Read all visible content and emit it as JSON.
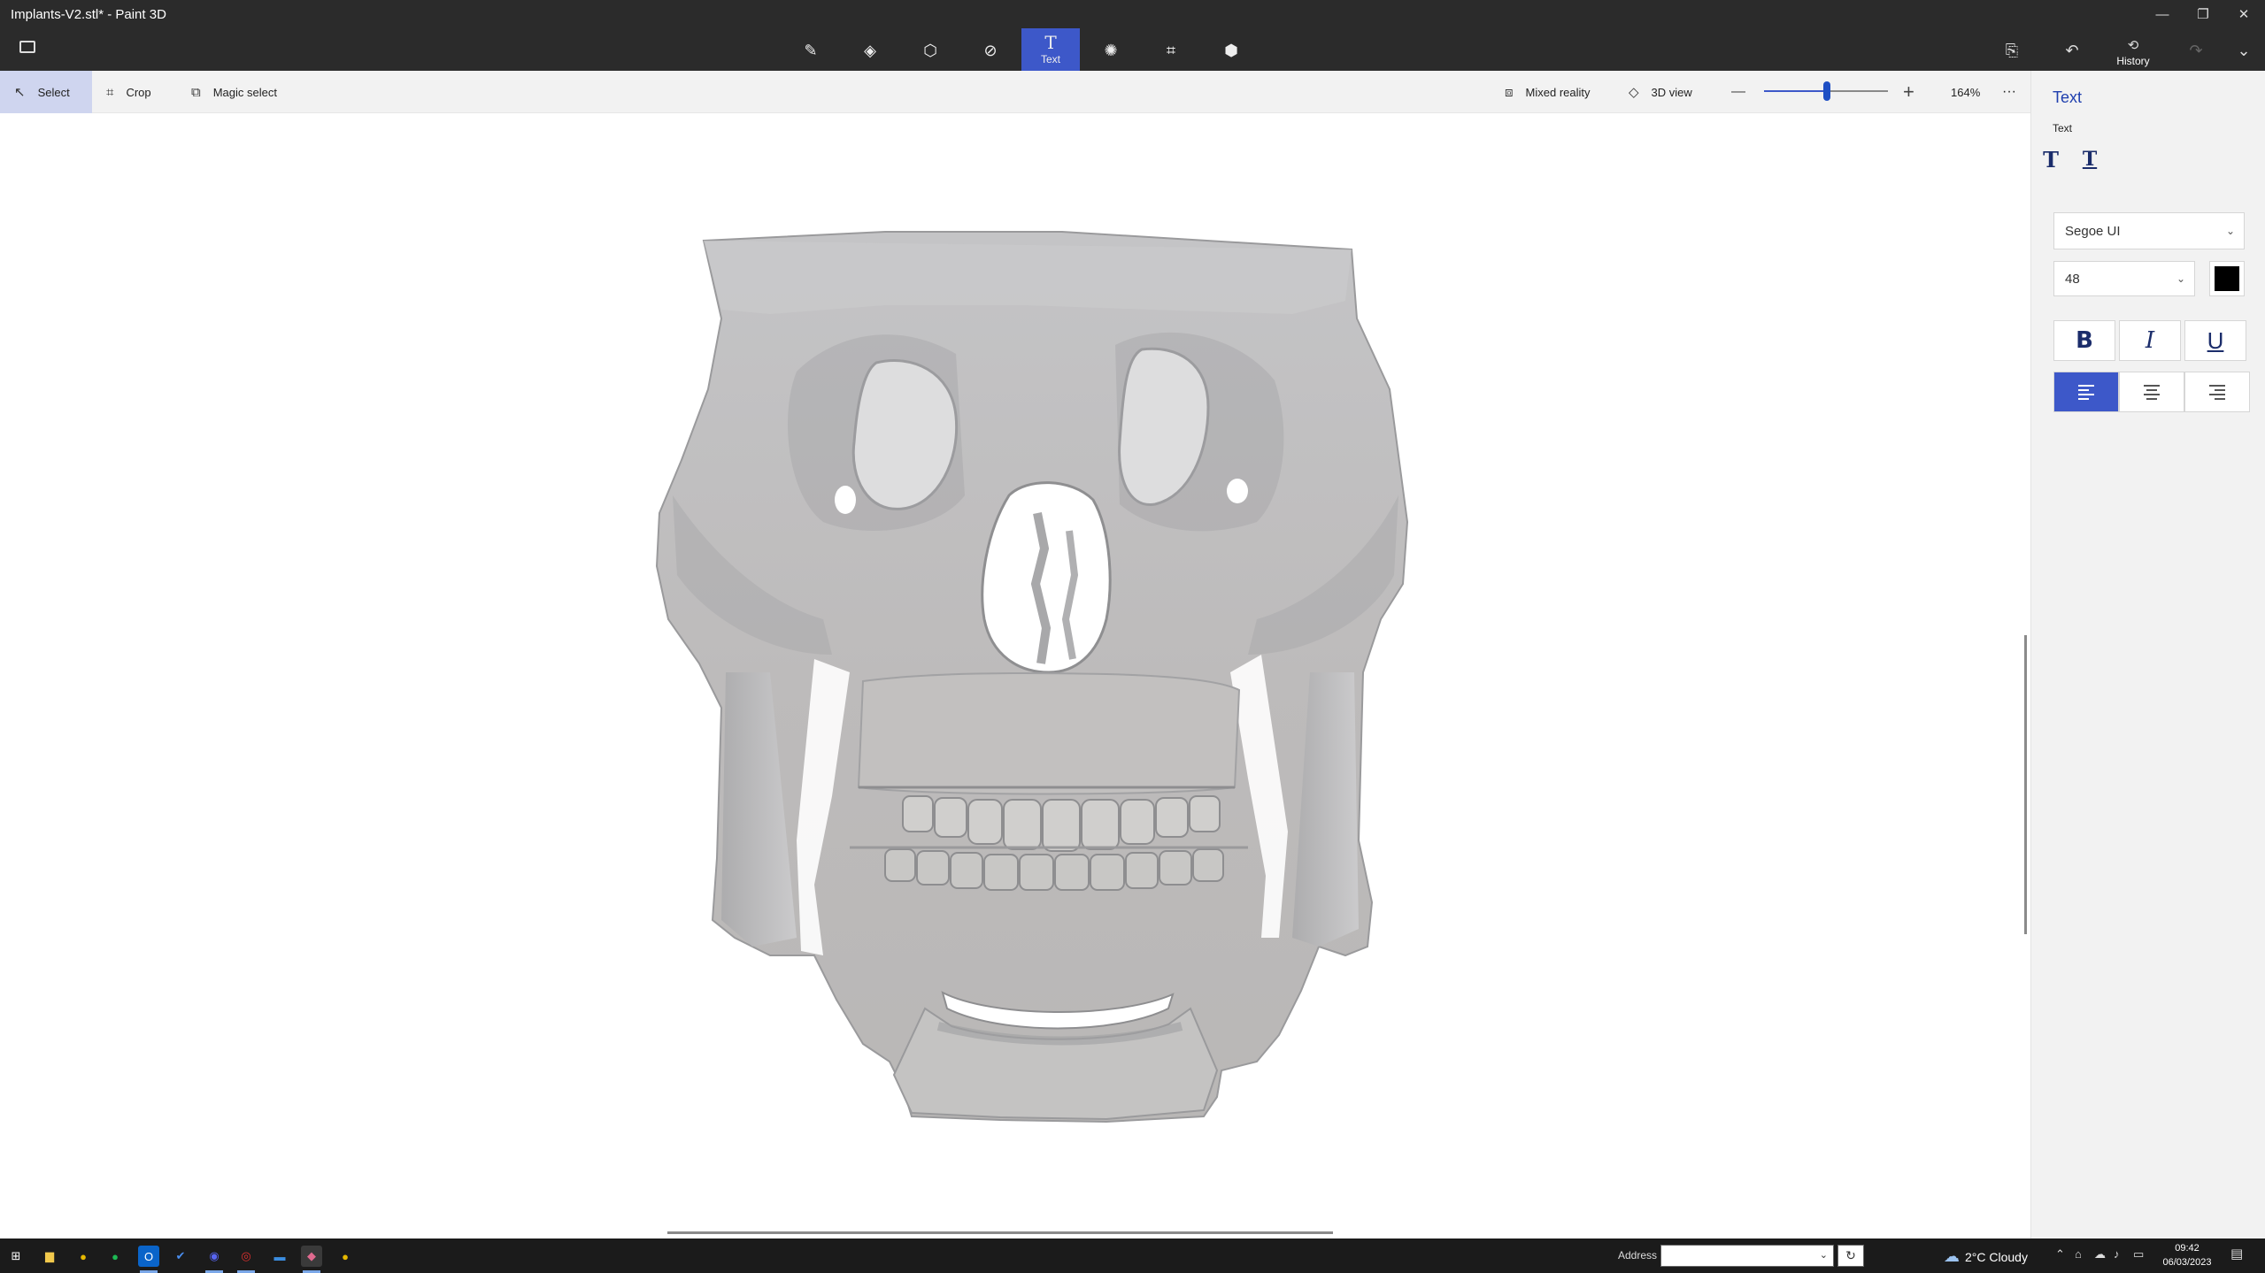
{
  "window": {
    "title": "Implants-V2.stl* - Paint 3D",
    "controls": {
      "minimize": "—",
      "restore": "❐",
      "close": "✕"
    }
  },
  "main_toolbar": {
    "tools": [
      {
        "name": "brushes",
        "icon": "brush-icon",
        "glyph": "✎",
        "label": ""
      },
      {
        "name": "2d-shapes",
        "icon": "2d-shapes-icon",
        "glyph": "◈",
        "label": ""
      },
      {
        "name": "3d-shapes",
        "icon": "3d-cube-icon",
        "glyph": "⬡",
        "label": ""
      },
      {
        "name": "stickers",
        "icon": "sticker-icon",
        "glyph": "⊘",
        "label": ""
      },
      {
        "name": "text",
        "icon": "text-icon",
        "glyph": "T",
        "label": "Text"
      },
      {
        "name": "effects",
        "icon": "effects-icon",
        "glyph": "✺",
        "label": ""
      },
      {
        "name": "canvas",
        "icon": "canvas-icon",
        "glyph": "⌗",
        "label": ""
      },
      {
        "name": "3d-library",
        "icon": "3d-library-icon",
        "glyph": "⬢",
        "label": ""
      }
    ],
    "active_tool": "text",
    "right": {
      "paste_glyph": "⎘",
      "undo_glyph": "↶",
      "history_label": "History",
      "history_glyph": "⟲",
      "redo_glyph": "↷",
      "expand_glyph": "⌄"
    }
  },
  "sub_toolbar": {
    "select_label": "Select",
    "crop_label": "Crop",
    "magic_select_label": "Magic select",
    "mixed_reality_label": "Mixed reality",
    "view_3d_label": "3D view",
    "zoom_out_glyph": "—",
    "zoom_in_glyph": "+",
    "zoom_level": "164%",
    "zoom_fraction": 0.52,
    "more_glyph": "···"
  },
  "text_panel": {
    "title": "Text",
    "section_label": "Text",
    "text_types": [
      "T",
      "T"
    ],
    "font_family": "Segoe UI",
    "font_size": "48",
    "text_color": "#000000",
    "bold": "B",
    "italic": "I",
    "underline": "U",
    "alignment": "left"
  },
  "taskbar": {
    "address_label": "Address",
    "address_value": "",
    "weather": "2°C  Cloudy",
    "time": "09:42",
    "date": "06/03/2023",
    "apps": [
      {
        "name": "start",
        "glyph": "⊞",
        "color": "#ffffff"
      },
      {
        "name": "file-explorer",
        "glyph": "▆",
        "color": "#f2c94c"
      },
      {
        "name": "chrome",
        "glyph": "●",
        "color": "#e6b800"
      },
      {
        "name": "spotify",
        "glyph": "●",
        "color": "#1db954"
      },
      {
        "name": "outlook",
        "glyph": "O",
        "color": "#0a64c9"
      },
      {
        "name": "todo",
        "glyph": "✔",
        "color": "#4a8ef0"
      },
      {
        "name": "discord",
        "glyph": "◉",
        "color": "#5865f2"
      },
      {
        "name": "recorder",
        "glyph": "◎",
        "color": "#e0312f"
      },
      {
        "name": "mail",
        "glyph": "▬",
        "color": "#3b8de0"
      },
      {
        "name": "paint-3d",
        "glyph": "◆",
        "color": "#e06a8f"
      },
      {
        "name": "chrome-2",
        "glyph": "●",
        "color": "#e6b800"
      }
    ]
  },
  "colors": {
    "accent": "#3d58c9",
    "titlebar": "#2b2b2b",
    "panel": "#f2f2f2",
    "taskbar": "#1b1b1b",
    "model": "#c9c9cb"
  },
  "canvas": {
    "model_description_icon": "skull-3d-model"
  }
}
